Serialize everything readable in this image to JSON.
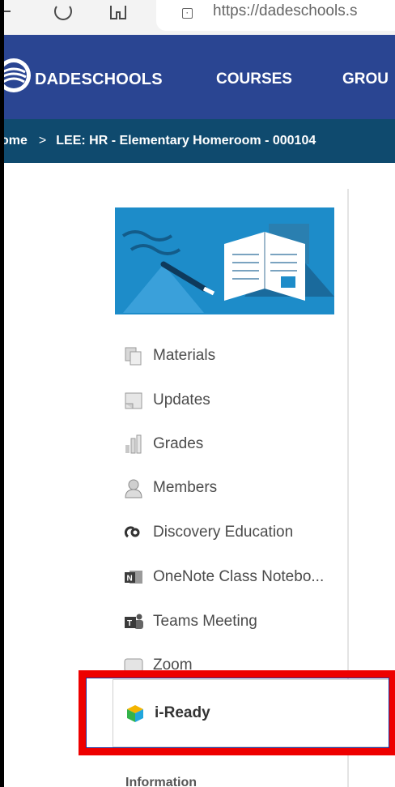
{
  "browser": {
    "url": "https://dadeschools.s"
  },
  "header": {
    "site_name": "DADESCHOOLS",
    "nav": [
      "COURSES",
      "GROU"
    ]
  },
  "breadcrumb": {
    "home": "ome",
    "separator": ">",
    "current": "LEE: HR - Elementary Homeroom - 000104"
  },
  "sidebar": {
    "items": [
      {
        "label": "Materials",
        "icon": "materials-icon"
      },
      {
        "label": "Updates",
        "icon": "updates-icon"
      },
      {
        "label": "Grades",
        "icon": "grades-icon"
      },
      {
        "label": "Members",
        "icon": "members-icon"
      },
      {
        "label": "Discovery Education",
        "icon": "discovery-education-icon"
      },
      {
        "label": "OneNote Class Notebo...",
        "icon": "onenote-icon"
      },
      {
        "label": "Teams Meeting",
        "icon": "teams-icon"
      },
      {
        "label": "Zoom",
        "icon": "zoom-icon"
      }
    ],
    "highlighted": {
      "label": "i-Ready",
      "icon": "i-ready-cube-icon"
    },
    "section_label": "Information"
  },
  "colors": {
    "header_bg": "#2a4592",
    "breadcrumb_bg": "#0f4a6e",
    "banner_bg": "#1d8cc9",
    "highlight": "#ee0000"
  }
}
